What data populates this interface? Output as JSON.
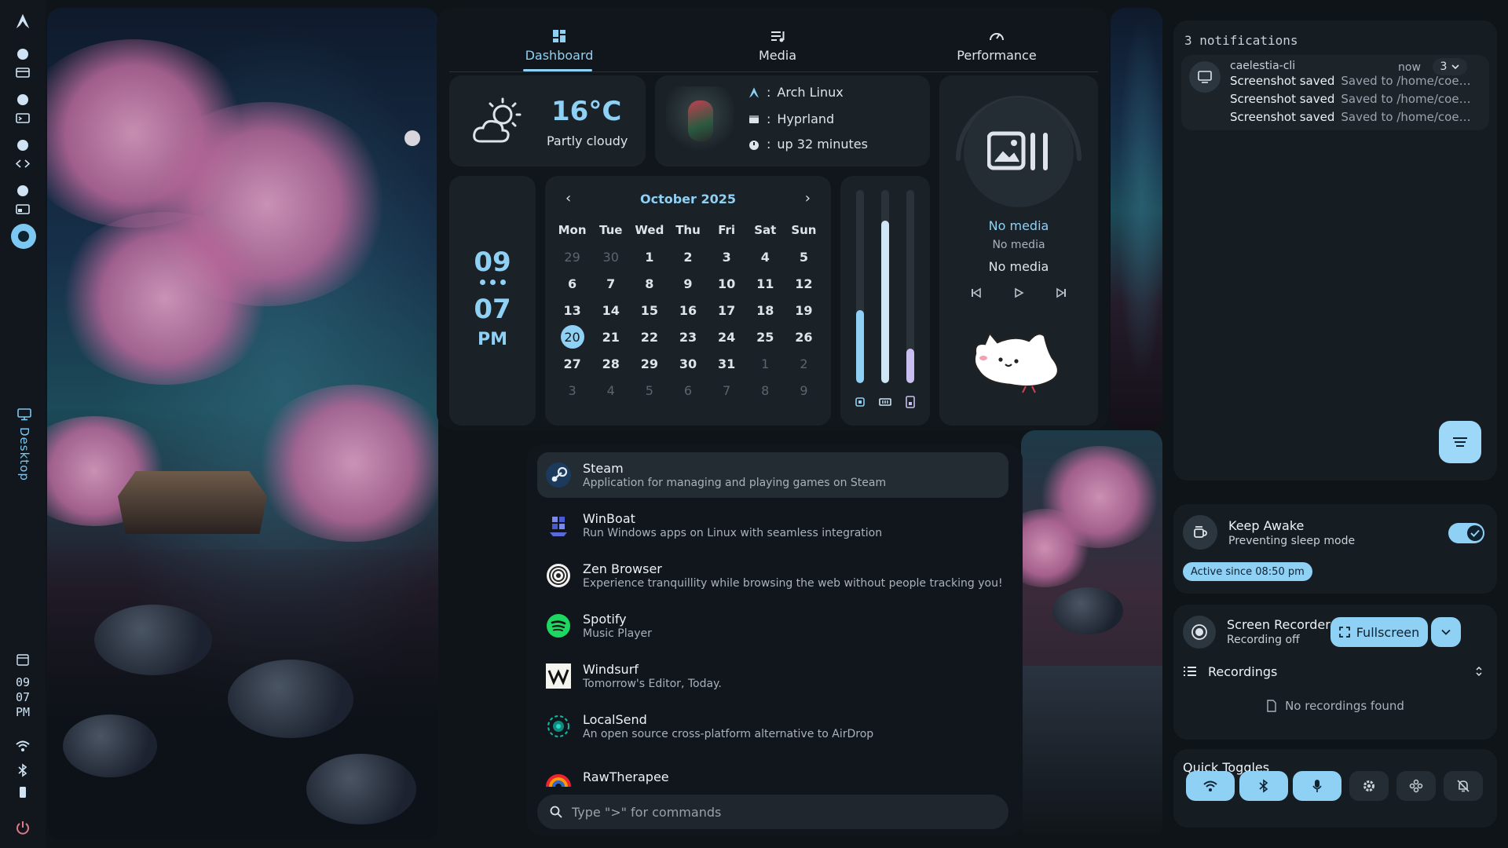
{
  "leftbar": {
    "clock": {
      "hour": "09",
      "minute": "07",
      "ampm": "PM"
    },
    "workspace_label": "Desktop"
  },
  "dashboard": {
    "tabs": [
      {
        "label": "Dashboard",
        "icon": "dashboard-icon",
        "active": true
      },
      {
        "label": "Media",
        "icon": "playlist-icon",
        "active": false
      },
      {
        "label": "Performance",
        "icon": "speedometer-icon",
        "active": false
      }
    ],
    "weather": {
      "temp": "16°C",
      "desc": "Partly cloudy",
      "icon": "partly-cloudy-icon"
    },
    "system": {
      "os": "Arch Linux",
      "wm": "Hyprland",
      "uptime": "up 32 minutes",
      "separator": ":"
    },
    "clock": {
      "hour": "09",
      "minute": "07",
      "ampm": "PM"
    },
    "calendar": {
      "month": "October 2025",
      "prev": "‹",
      "next": "›",
      "dow": [
        "Mon",
        "Tue",
        "Wed",
        "Thu",
        "Fri",
        "Sat",
        "Sun"
      ],
      "days": [
        {
          "d": "29",
          "dim": true
        },
        {
          "d": "30",
          "dim": true
        },
        {
          "d": "1"
        },
        {
          "d": "2"
        },
        {
          "d": "3"
        },
        {
          "d": "4"
        },
        {
          "d": "5"
        },
        {
          "d": "6"
        },
        {
          "d": "7"
        },
        {
          "d": "8"
        },
        {
          "d": "9"
        },
        {
          "d": "10"
        },
        {
          "d": "11"
        },
        {
          "d": "12"
        },
        {
          "d": "13"
        },
        {
          "d": "14"
        },
        {
          "d": "15"
        },
        {
          "d": "16"
        },
        {
          "d": "17"
        },
        {
          "d": "18"
        },
        {
          "d": "19"
        },
        {
          "d": "20",
          "today": true
        },
        {
          "d": "21"
        },
        {
          "d": "22"
        },
        {
          "d": "23"
        },
        {
          "d": "24"
        },
        {
          "d": "25"
        },
        {
          "d": "26"
        },
        {
          "d": "27"
        },
        {
          "d": "28"
        },
        {
          "d": "29"
        },
        {
          "d": "30"
        },
        {
          "d": "31"
        },
        {
          "d": "1",
          "dim": true
        },
        {
          "d": "2",
          "dim": true
        },
        {
          "d": "3",
          "dim": true
        },
        {
          "d": "4",
          "dim": true
        },
        {
          "d": "5",
          "dim": true
        },
        {
          "d": "6",
          "dim": true
        },
        {
          "d": "7",
          "dim": true
        },
        {
          "d": "8",
          "dim": true
        },
        {
          "d": "9",
          "dim": true
        }
      ]
    },
    "resources": [
      {
        "name": "cpu",
        "icon": "cpu-icon",
        "level": 0.38,
        "color": "#8fd0f5"
      },
      {
        "name": "memory",
        "icon": "memory-icon",
        "level": 0.84,
        "color": "#cfe6f6"
      },
      {
        "name": "storage",
        "icon": "storage-icon",
        "level": 0.18,
        "color": "#c8bff0"
      }
    ],
    "media": {
      "title": "No media",
      "artist": "No media",
      "album": "No media"
    }
  },
  "launcher": {
    "apps": [
      {
        "name": "Steam",
        "desc": "Application for managing and playing games on Steam",
        "icon": "steam-icon"
      },
      {
        "name": "WinBoat",
        "desc": "Run Windows apps on Linux with seamless integration",
        "icon": "winboat-icon"
      },
      {
        "name": "Zen Browser",
        "desc": "Experience tranquillity while browsing the web without people tracking you!",
        "icon": "zen-browser-icon"
      },
      {
        "name": "Spotify",
        "desc": "Music Player",
        "icon": "spotify-icon"
      },
      {
        "name": "Windsurf",
        "desc": "Tomorrow's Editor, Today.",
        "icon": "windsurf-icon"
      },
      {
        "name": "LocalSend",
        "desc": "An open source cross-platform alternative to AirDrop",
        "icon": "localsend-icon"
      },
      {
        "name": "RawTherapee",
        "desc": "",
        "icon": "rawtherapee-icon"
      }
    ],
    "search_placeholder": "Type \">\" for commands"
  },
  "sidebar": {
    "notifications": {
      "header": "3 notifications",
      "app": "caelestia-cli",
      "time": "now",
      "count": "3",
      "items": [
        {
          "title": "Screenshot saved",
          "body": "Saved to /home/coe…"
        },
        {
          "title": "Screenshot saved",
          "body": "Saved to /home/coe…"
        },
        {
          "title": "Screenshot saved",
          "body": "Saved to /home/coe…"
        }
      ]
    },
    "keep_awake": {
      "title": "Keep Awake",
      "subtitle": "Preventing sleep mode",
      "badge": "Active since 08:50 pm",
      "enabled": true
    },
    "recorder": {
      "title": "Screen Recorder",
      "subtitle": "Recording off",
      "mode": "Fullscreen",
      "recordings_label": "Recordings",
      "empty": "No recordings found"
    },
    "quick_toggles": {
      "title": "Quick Toggles",
      "items": [
        {
          "name": "wifi",
          "icon": "wifi-icon",
          "on": true
        },
        {
          "name": "bluetooth",
          "icon": "bluetooth-icon",
          "on": true
        },
        {
          "name": "microphone",
          "icon": "microphone-icon",
          "on": true
        },
        {
          "name": "settings",
          "icon": "gear-icon",
          "on": false
        },
        {
          "name": "game-mode",
          "icon": "gamepad-icon",
          "on": false
        },
        {
          "name": "do-not-disturb",
          "icon": "bell-off-icon",
          "on": false
        }
      ]
    }
  },
  "colors": {
    "accent": "#8fd0f5",
    "surface": "#1a2127",
    "background": "#0f1418"
  }
}
